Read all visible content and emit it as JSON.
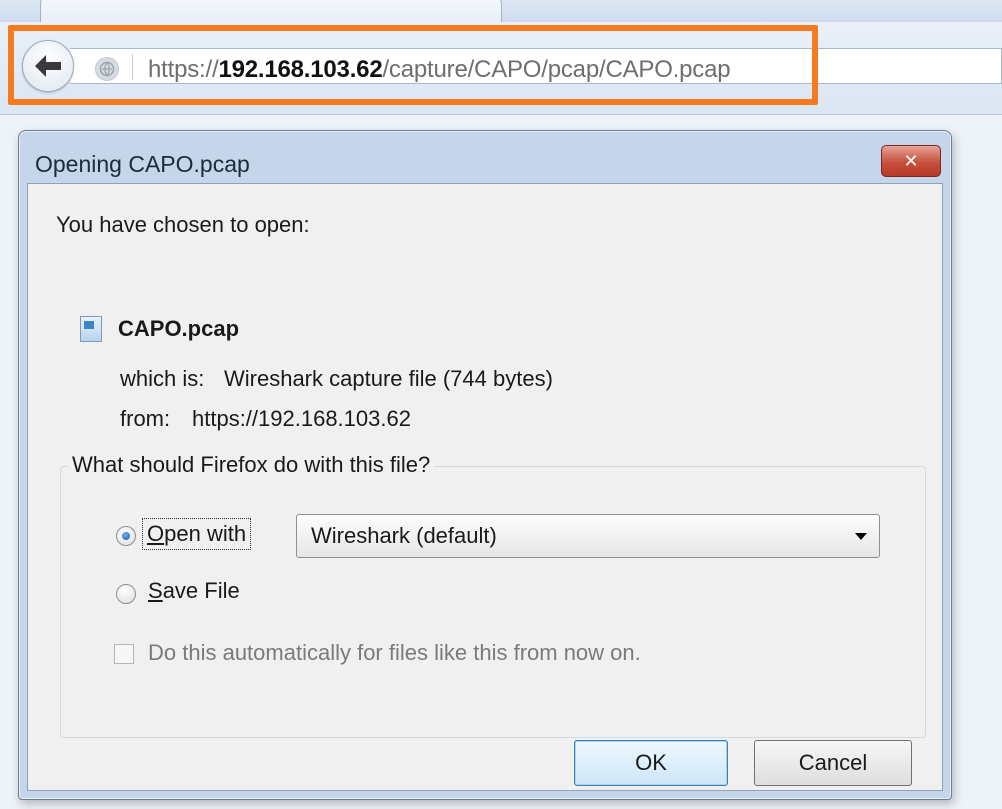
{
  "browser": {
    "url_prefix": "https://",
    "url_host": "192.168.103.62",
    "url_path": "/capture/CAPO/pcap/CAPO.pcap"
  },
  "dialog": {
    "title": "Opening CAPO.pcap",
    "intro": "You have chosen to open:",
    "filename": "CAPO.pcap",
    "which_is_label": "which is:",
    "which_is_value": "Wireshark capture file (744 bytes)",
    "from_label": "from:",
    "from_value": "https://192.168.103.62",
    "question": "What should Firefox do with this file?",
    "open_with_label": "Open with",
    "open_with_app": "Wireshark (default)",
    "save_file_label": "Save File",
    "auto_label": "Do this automatically for files like this from now on.",
    "ok_label": "OK",
    "cancel_label": "Cancel"
  },
  "colors": {
    "highlight": "#f47b20",
    "close_button": "#c7503d"
  },
  "icons": [
    "back-arrow-icon",
    "site-identity-icon",
    "file-icon",
    "close-icon",
    "dropdown-arrow-icon"
  ]
}
